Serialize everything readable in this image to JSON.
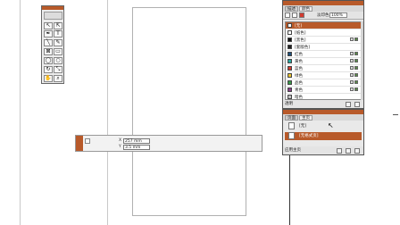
{
  "colors": {
    "accent": "#b85a2a"
  },
  "toolbox": {
    "tools": [
      "selection-tool-icon",
      "direct-selection-tool-icon",
      "pen-tool-icon",
      "type-tool-icon",
      "line-tool-icon",
      "pencil-tool-icon",
      "rectangle-frame-tool-icon",
      "rectangle-tool-icon",
      "ellipse-frame-tool-icon",
      "ellipse-tool-icon",
      "rotate-tool-icon",
      "scale-tool-icon",
      "hand-tool-icon",
      "zoom-tool-icon"
    ],
    "type_glyph": "T"
  },
  "swatches_panel": {
    "tabs": [
      "描述",
      "颜色"
    ],
    "tint_label": "淡印色：",
    "tint_value": "100%",
    "items": [
      {
        "label": "[无]",
        "color": "#ffffff",
        "selected": true
      },
      {
        "label": "[纸色]",
        "color": "#ffffff"
      },
      {
        "label": "[黑色]",
        "color": "#111111"
      },
      {
        "label": "[套版色]",
        "color": "#222222"
      },
      {
        "label": "红色",
        "color": "#1f4f7a"
      },
      {
        "label": "黄色",
        "color": "#2aa8a0"
      },
      {
        "label": "蓝色",
        "color": "#d23b30"
      },
      {
        "label": "绿色",
        "color": "#e7c230"
      },
      {
        "label": "品色",
        "color": "#3a9a4a"
      },
      {
        "label": "青色",
        "color": "#8a3f8a"
      },
      {
        "label": "暗色",
        "color": "#c0c0c0"
      }
    ],
    "footer_label": "透明"
  },
  "pages_panel": {
    "tabs": [
      "页面",
      "主页"
    ],
    "items": [
      "[无]",
      "[无格式页]"
    ],
    "footer_label": "应用主页"
  },
  "control_panel": {
    "x_label": "X",
    "x_value": "257 mm",
    "y_label": "Y",
    "y_value": "3.5 mm"
  }
}
